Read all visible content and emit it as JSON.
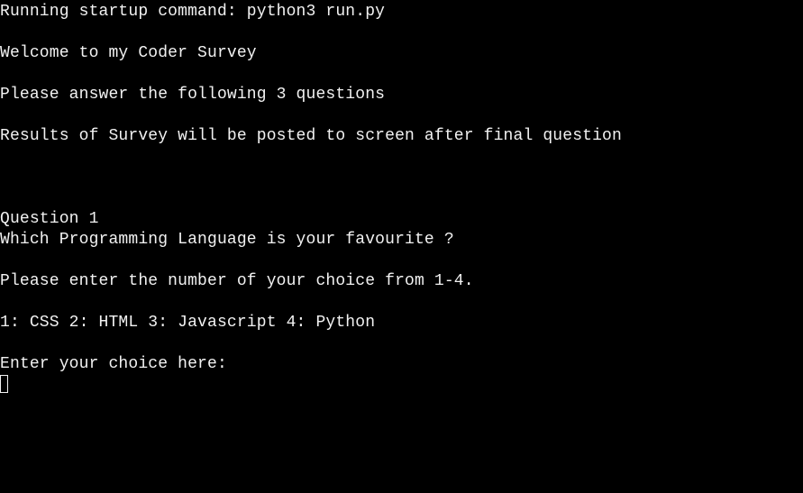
{
  "terminal": {
    "lines": {
      "startup": "Running startup command: python3 run.py",
      "welcome": "Welcome to my Coder Survey",
      "instructions": "Please answer the following 3 questions",
      "results_note": "Results of Survey will be posted to screen after final question",
      "question_number": "Question 1",
      "question_text": "Which Programming Language is your favourite ?",
      "choice_prompt": "Please enter the number of your choice from 1-4.",
      "options": "1: CSS 2: HTML 3: Javascript 4: Python",
      "input_prompt": "Enter your choice here:"
    },
    "colors": {
      "background": "#000000",
      "foreground": "#f2f2f2"
    }
  }
}
